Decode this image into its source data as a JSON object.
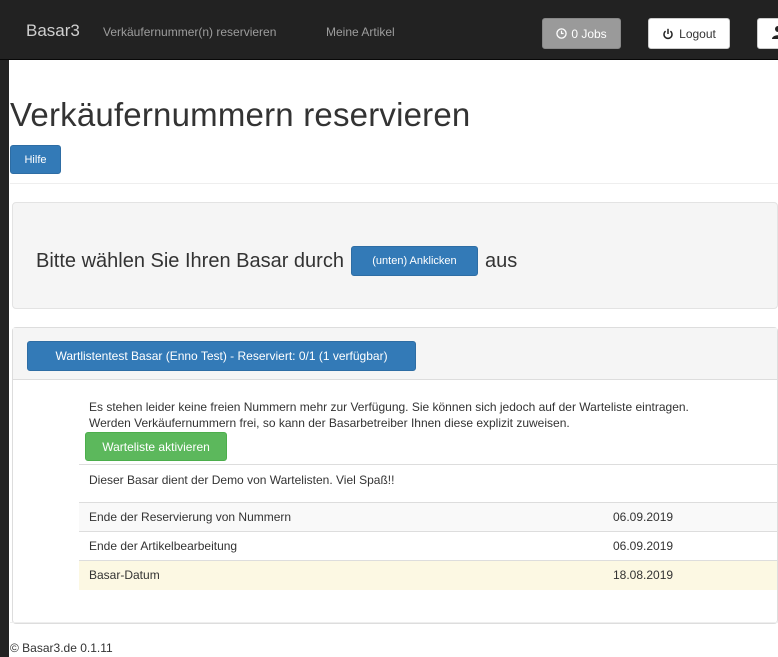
{
  "navbar": {
    "brand": "Basar3",
    "links": [
      "Verkäufernummer(n) reservieren",
      "Meine Artikel"
    ],
    "jobs_button": "0 Jobs",
    "logout_button": "Logout"
  },
  "page": {
    "title": "Verkäufernummern reservieren",
    "help_button": "Hilfe"
  },
  "jumbotron": {
    "text_before": "Bitte wählen Sie Ihren Basar durch",
    "button": "(unten) Anklicken",
    "text_after": "aus"
  },
  "basar": {
    "button": "Wartlistentest Basar (Enno Test) - Reserviert: 0/1 (1 verfügbar)",
    "info_line1": "Es stehen leider keine freien Nummern mehr zur Verfügung. Sie können sich jedoch auf der Warteliste eintragen.",
    "info_line2": "Werden Verkäufernummern frei, so kann der Basarbetreiber Ihnen diese explizit zuweisen.",
    "waitlist_button": "Warteliste aktivieren",
    "description": "Dieser Basar dient der Demo von Wartelisten. Viel Spaß!!",
    "dates": [
      {
        "label": "Ende der Reservierung von Nummern",
        "value": "06.09.2019"
      },
      {
        "label": "Ende der Artikelbearbeitung",
        "value": "06.09.2019"
      },
      {
        "label": "Basar-Datum",
        "value": "18.08.2019"
      }
    ]
  },
  "footer": {
    "text": "© Basar3.de 0.1.11"
  },
  "colors": {
    "primary": "#337ab7",
    "success": "#5cb85c",
    "navbar": "#222222",
    "warning_row": "#fcf8e3"
  }
}
